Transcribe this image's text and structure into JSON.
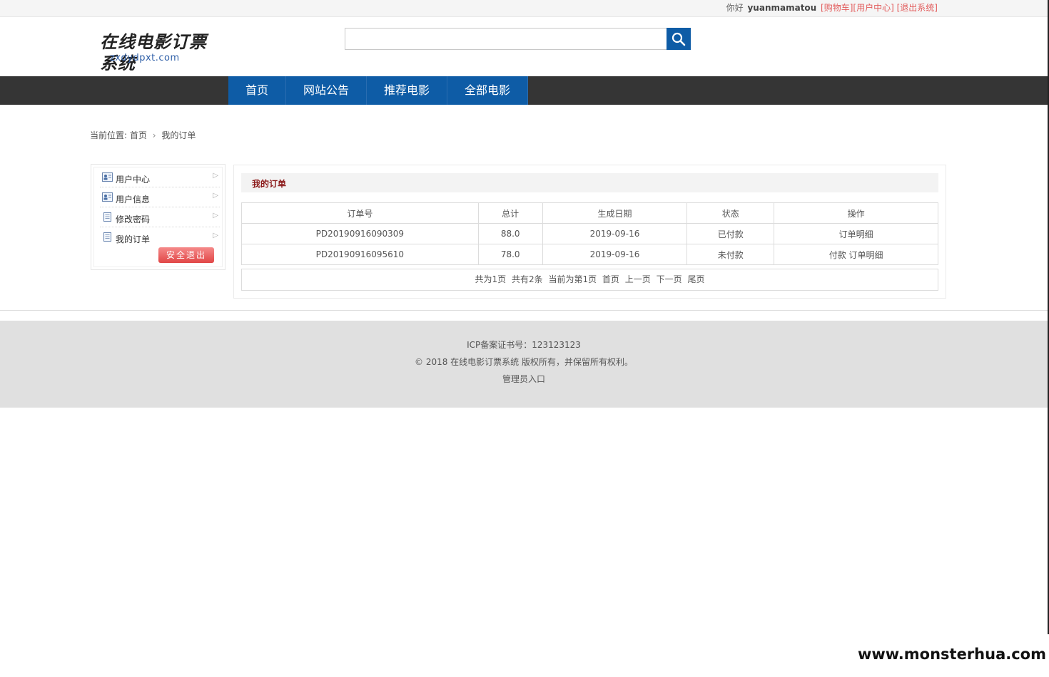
{
  "topbar": {
    "greeting": "你好",
    "username": "yuanmamatou",
    "cart_link": "[购物车]",
    "user_center_link": "[用户中心]",
    "logout_link": "[退出系统]"
  },
  "header": {
    "logo_cn": "在线电影订票系统",
    "logo_en": "zxdydpxt.com",
    "search_value": "",
    "search_placeholder": ""
  },
  "nav": {
    "items": [
      {
        "label": "首页"
      },
      {
        "label": "网站公告"
      },
      {
        "label": "推荐电影"
      },
      {
        "label": "全部电影"
      }
    ]
  },
  "breadcrumb": {
    "prefix": "当前位置:",
    "home": "首页",
    "separator": "›",
    "current": "我的订单"
  },
  "sidebar": {
    "items": [
      {
        "label": "用户中心",
        "icon": "user-card-icon"
      },
      {
        "label": "用户信息",
        "icon": "user-card-icon"
      },
      {
        "label": "修改密码",
        "icon": "document-icon"
      },
      {
        "label": "我的订单",
        "icon": "document-icon"
      }
    ],
    "arrow": "▷",
    "logout_button": "安全退出"
  },
  "orders": {
    "title": "我的订单",
    "columns": [
      "订单号",
      "总计",
      "生成日期",
      "状态",
      "操作"
    ],
    "rows": [
      {
        "order_no": "PD20190916090309",
        "total": "88.0",
        "date": "2019-09-16",
        "status": "已付款",
        "pay": "",
        "detail": "订单明细"
      },
      {
        "order_no": "PD20190916095610",
        "total": "78.0",
        "date": "2019-09-16",
        "status": "未付款",
        "pay": "付款",
        "detail": "订单明细"
      }
    ]
  },
  "pager": {
    "total_pages": "共为1页",
    "total_items": "共有2条",
    "current": "当前为第1页",
    "first": "首页",
    "prev": "上一页",
    "next": "下一页",
    "last": "尾页"
  },
  "footer": {
    "icp": "ICP备案证书号：123123123",
    "copyright": "© 2018 在线电影订票系统 版权所有，并保留所有权利。",
    "admin_link": "管理员入口"
  },
  "watermark": "www.monsterhua.com",
  "colors": {
    "nav_active": "#0e5ca6",
    "nav_bar": "#353535",
    "link_red": "#e25b5b",
    "title_red": "#8b1a1a",
    "logout_button": "#e14646"
  }
}
